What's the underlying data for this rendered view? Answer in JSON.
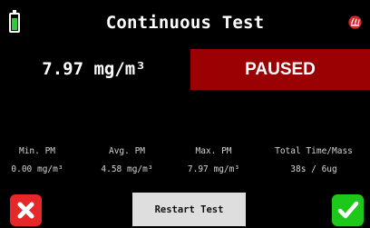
{
  "header": {
    "title": "Continuous Test",
    "battery_level": 0.85,
    "battery_color": "#34c93c",
    "logo_icon": "brand-logo-icon"
  },
  "reading": {
    "value": "7.97 mg/m³",
    "status": "PAUSED",
    "status_color": "#9b0003"
  },
  "stats": [
    {
      "label": "Min. PM",
      "value": "0.00 mg/m³"
    },
    {
      "label": "Avg. PM",
      "value": "4.58 mg/m³"
    },
    {
      "label": "Max. PM",
      "value": "7.97 mg/m³"
    },
    {
      "label": "Total Time/Mass",
      "value": "38s / 6ug"
    }
  ],
  "actions": {
    "cancel_icon": "close-icon",
    "cancel_color": "#e8272a",
    "restart_label": "Restart Test",
    "confirm_icon": "check-icon",
    "confirm_color": "#1ec81a"
  }
}
